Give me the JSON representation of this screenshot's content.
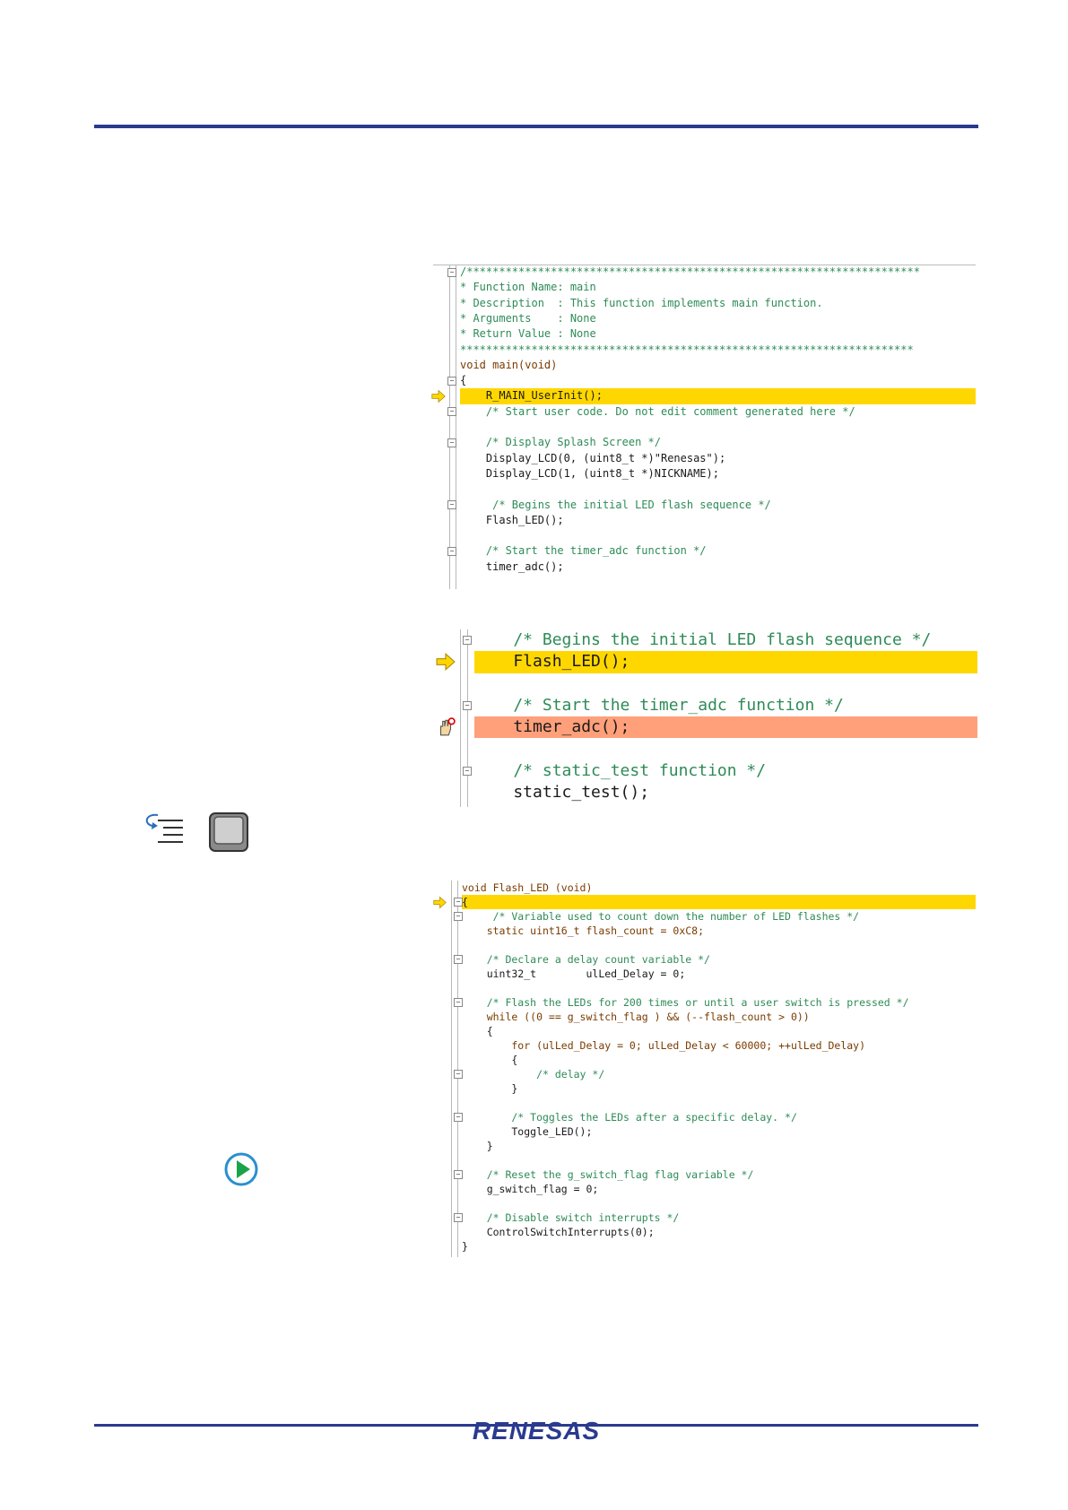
{
  "panel1": {
    "lines": [
      {
        "t": "/**********************************************************************",
        "c": "cm"
      },
      {
        "t": "* Function Name: main",
        "c": "cm"
      },
      {
        "t": "* Description  : This function implements main function.",
        "c": "cm"
      },
      {
        "t": "* Arguments    : None",
        "c": "cm"
      },
      {
        "t": "* Return Value : None",
        "c": "cm"
      },
      {
        "t": "**********************************************************************",
        "c": "cm"
      },
      {
        "t": "void main(void)",
        "c": "kw"
      },
      {
        "t": "{",
        "c": "plain"
      },
      {
        "t": "    R_MAIN_UserInit();",
        "c": "plain",
        "hl": "yellow"
      },
      {
        "t": "    /* Start user code. Do not edit comment generated here */",
        "c": "cm"
      },
      {
        "t": "",
        "c": "plain"
      },
      {
        "t": "    /* Display Splash Screen */",
        "c": "cm"
      },
      {
        "t": "    Display_LCD(0, (uint8_t *)\"Renesas\");",
        "c": "plain"
      },
      {
        "t": "    Display_LCD(1, (uint8_t *)NICKNAME);",
        "c": "plain"
      },
      {
        "t": "",
        "c": "plain"
      },
      {
        "t": "     /* Begins the initial LED flash sequence */",
        "c": "cm"
      },
      {
        "t": "    Flash_LED();",
        "c": "plain"
      },
      {
        "t": "",
        "c": "plain"
      },
      {
        "t": "    /* Start the timer_adc function */",
        "c": "cm"
      },
      {
        "t": "    timer_adc();",
        "c": "plain"
      }
    ]
  },
  "panel2": {
    "lines": [
      {
        "t": "    /* Begins the initial LED flash sequence */",
        "c": "cm"
      },
      {
        "t": "    Flash_LED();",
        "c": "plain",
        "hl": "yellow"
      },
      {
        "t": "",
        "c": "plain"
      },
      {
        "t": "    /* Start the timer_adc function */",
        "c": "cm"
      },
      {
        "t": "    timer_adc();",
        "c": "plain",
        "hl": "red"
      },
      {
        "t": "",
        "c": "plain"
      },
      {
        "t": "    /* static_test function */",
        "c": "cm"
      },
      {
        "t": "    static_test();",
        "c": "plain"
      }
    ]
  },
  "panel3": {
    "lines": [
      {
        "t": "void Flash_LED (void)",
        "c": "kw"
      },
      {
        "t": "{",
        "c": "plain",
        "hl": "yellow"
      },
      {
        "t": "     /* Variable used to count down the number of LED flashes */",
        "c": "cm"
      },
      {
        "t": "    static uint16_t flash_count = 0xC8;",
        "c": "kw"
      },
      {
        "t": "",
        "c": "plain"
      },
      {
        "t": "    /* Declare a delay count variable */",
        "c": "cm"
      },
      {
        "t": "    uint32_t        ulLed_Delay = 0;",
        "c": "plain"
      },
      {
        "t": "",
        "c": "plain"
      },
      {
        "t": "    /* Flash the LEDs for 200 times or until a user switch is pressed */",
        "c": "cm"
      },
      {
        "t": "    while ((0 == g_switch_flag ) && (--flash_count > 0))",
        "c": "kw"
      },
      {
        "t": "    {",
        "c": "plain"
      },
      {
        "t": "        for (ulLed_Delay = 0; ulLed_Delay < 60000; ++ulLed_Delay)",
        "c": "kw"
      },
      {
        "t": "        {",
        "c": "plain"
      },
      {
        "t": "            /* delay */",
        "c": "cm"
      },
      {
        "t": "        }",
        "c": "plain"
      },
      {
        "t": "",
        "c": "plain"
      },
      {
        "t": "        /* Toggles the LEDs after a specific delay. */",
        "c": "cm"
      },
      {
        "t": "        Toggle_LED();",
        "c": "plain"
      },
      {
        "t": "    }",
        "c": "plain"
      },
      {
        "t": "",
        "c": "plain"
      },
      {
        "t": "    /* Reset the g_switch_flag flag variable */",
        "c": "cm"
      },
      {
        "t": "    g_switch_flag = 0;",
        "c": "plain"
      },
      {
        "t": "",
        "c": "plain"
      },
      {
        "t": "    /* Disable switch interrupts */",
        "c": "cm"
      },
      {
        "t": "    ControlSwitchInterrupts(0);",
        "c": "plain"
      },
      {
        "t": "}",
        "c": "plain"
      }
    ]
  },
  "footer": {
    "logo_text": "RENESAS"
  },
  "icons": {
    "step_over": "step-over-icon",
    "stop": "stop-button-icon",
    "run": "run-icon"
  }
}
